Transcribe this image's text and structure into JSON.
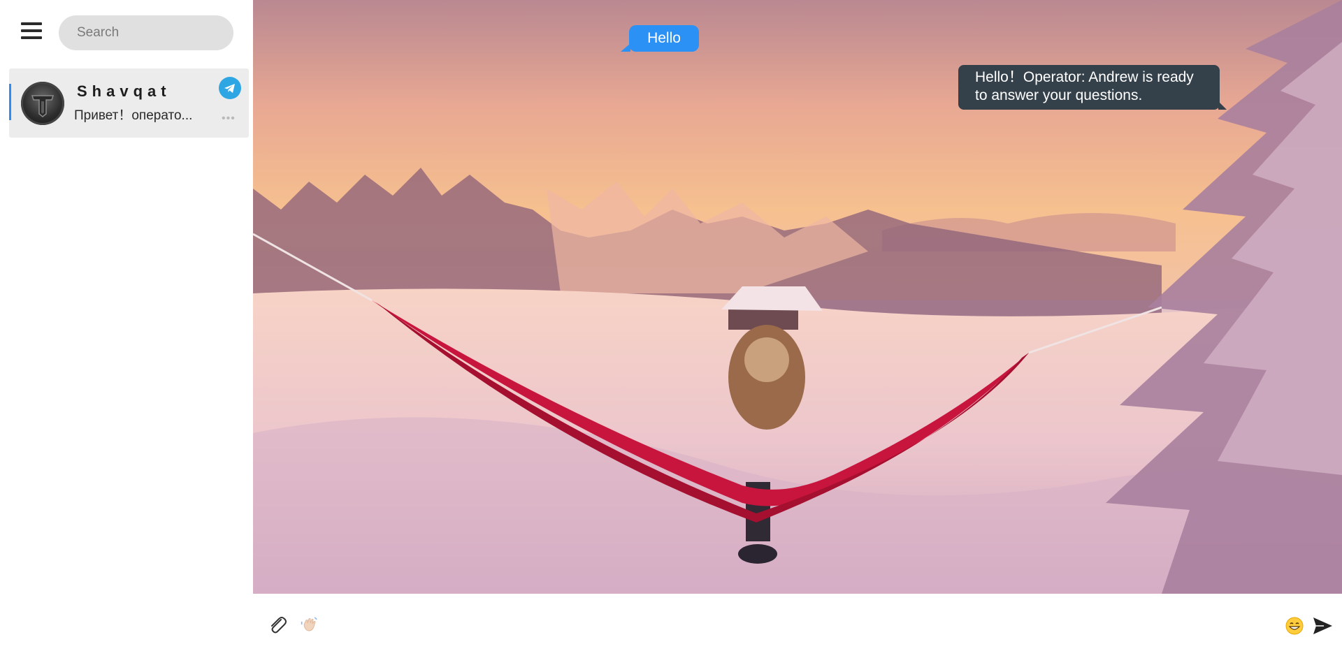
{
  "sidebar": {
    "menu_icon": "hamburger-icon",
    "search": {
      "placeholder": "Search",
      "value": ""
    },
    "chats": [
      {
        "name": "Shavqat",
        "preview": "Привет！операто...",
        "channel_icon": "telegram-icon",
        "more_icon": "ellipsis-icon",
        "active": true
      }
    ]
  },
  "conversation": {
    "background_icon": "winter-hammock-wallpaper",
    "messages": [
      {
        "direction": "outgoing",
        "text": "Hello"
      },
      {
        "direction": "incoming",
        "text": "Hello！Operator: Andrew is ready to answer your questions."
      }
    ]
  },
  "composer": {
    "attach_icon": "paperclip-icon",
    "wave_icon": "waving-hand-icon",
    "message": {
      "placeholder": "",
      "value": ""
    },
    "emoji_icon": "smiley-icon",
    "send_icon": "send-icon"
  },
  "colors": {
    "accent": "#2b91f5",
    "incoming_bubble": "#34404a",
    "telegram": "#2ea6e3",
    "selected_chat": "#ececec"
  }
}
